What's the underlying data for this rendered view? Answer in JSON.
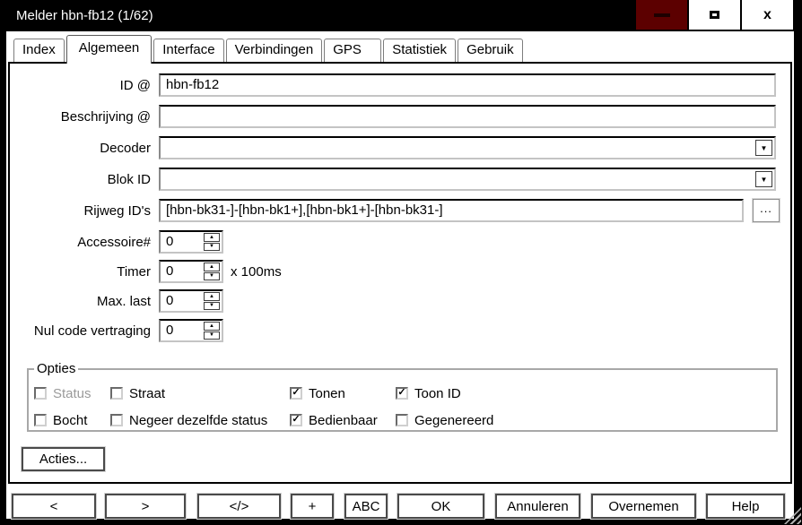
{
  "window": {
    "title": "Melder hbn-fb12 (1/62)"
  },
  "icons": {
    "minimize": "minimize-dash",
    "maximize": "maximize-square",
    "close": "x",
    "combo_arrow": "▼",
    "spin_up": "▲",
    "spin_down": "▼",
    "check": "✓",
    "ellipsis": "..."
  },
  "colors": {
    "titlebar": "#000000",
    "minimize_button_bg": "#5c0000",
    "dialog_bg": "#ffffff"
  },
  "tabs": [
    {
      "label": "Index",
      "active": false
    },
    {
      "label": "Algemeen",
      "active": true
    },
    {
      "label": "Interface",
      "active": false
    },
    {
      "label": "Verbindingen",
      "active": false
    },
    {
      "label": "GPS",
      "active": false
    },
    {
      "label": "Statistiek",
      "active": false
    },
    {
      "label": "Gebruik",
      "active": false
    }
  ],
  "form": {
    "fields": [
      {
        "label": "ID @",
        "value": "hbn-fb12",
        "type": "text"
      },
      {
        "label": "Beschrijving @",
        "value": "",
        "type": "text"
      },
      {
        "label": "Decoder",
        "value": "",
        "type": "combo"
      },
      {
        "label": "Blok ID",
        "value": "",
        "type": "combo"
      },
      {
        "label": "Rijweg ID's",
        "value": "[hbn-bk31-]-[hbn-bk1+],[hbn-bk1+]-[hbn-bk31-]",
        "type": "text-with-browse"
      },
      {
        "label": "Accessoire#",
        "value": "0",
        "type": "spinner"
      },
      {
        "label": "Timer",
        "value": "0",
        "type": "spinner",
        "suffix": "x 100ms"
      },
      {
        "label": "Max. last",
        "value": "0",
        "type": "spinner"
      },
      {
        "label": "Nul code vertraging",
        "value": "0",
        "type": "spinner"
      }
    ]
  },
  "opties": {
    "title": "Opties",
    "checkboxes": [
      {
        "label": "Status",
        "checked": false,
        "disabled": true
      },
      {
        "label": "Straat",
        "checked": false,
        "disabled": false
      },
      {
        "label": "Tonen",
        "checked": true,
        "disabled": false
      },
      {
        "label": "Toon ID",
        "checked": true,
        "disabled": false
      },
      {
        "label": "Bocht",
        "checked": false,
        "disabled": false
      },
      {
        "label": "Negeer dezelfde status",
        "checked": false,
        "disabled": false
      },
      {
        "label": "Bedienbaar",
        "checked": true,
        "disabled": false
      },
      {
        "label": "Gegenereerd",
        "checked": false,
        "disabled": false
      }
    ]
  },
  "acties_button": "Acties...",
  "bottom_buttons": [
    {
      "label": "<"
    },
    {
      "label": ">"
    },
    {
      "label": "</>"
    },
    {
      "label": "+"
    },
    {
      "label": "ABC"
    },
    {
      "label": "OK"
    },
    {
      "label": "Annuleren"
    },
    {
      "label": "Overnemen"
    },
    {
      "label": "Help"
    }
  ]
}
